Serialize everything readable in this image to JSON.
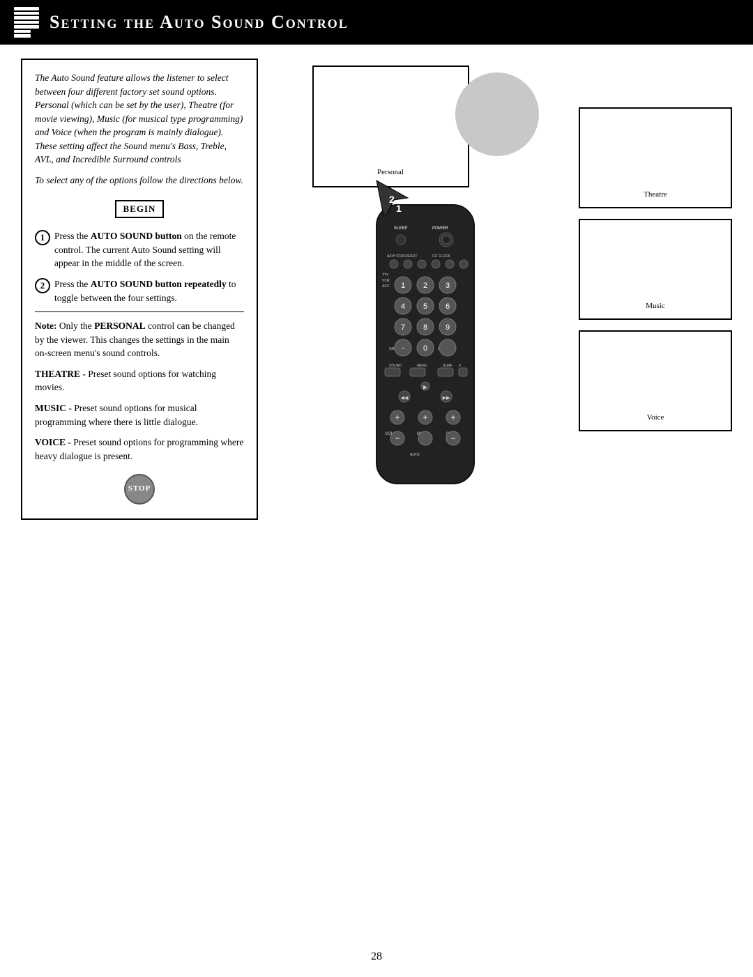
{
  "header": {
    "title": "Setting the Auto Sound Control",
    "icon_label": "remote-icon"
  },
  "instruction_box": {
    "intro": "The Auto Sound feature allows the listener to select between four different factory set sound options. Personal (which can be set by the user), Theatre (for movie viewing), Music (for musical type programming) and Voice (when the program is mainly dialogue). These setting affect the Sound menu's Bass, Treble, AVL, and Incredible Surround controls",
    "intro2": "To select any of the options follow the directions below.",
    "begin_label": "BEGIN",
    "steps": [
      {
        "number": "1",
        "text_before": "Press the ",
        "text_bold": "AUTO  SOUND button",
        "text_after": " on the remote control. The current Auto Sound setting will appear in the middle of the screen."
      },
      {
        "number": "2",
        "text_before": "Press the ",
        "text_bold": "AUTO  SOUND button",
        "text_after_bold": " repeatedly",
        "text_after": " to toggle between the four settings."
      }
    ],
    "note_label": "Note:",
    "note_text": " Only the ",
    "note_bold": "PERSONAL",
    "note_rest": " control can be changed by the viewer. This changes the settings in the main on-screen menu's sound controls.",
    "theatre_bold": "THEATRE",
    "theatre_text": " - Preset sound options for watching movies.",
    "music_bold": "MUSIC",
    "music_text": " - Preset sound options for musical programming where there is little dialogue.",
    "voice_bold": "VOICE",
    "voice_text": " - Preset sound options for programming where heavy dialogue is present.",
    "stop_label": "Stop"
  },
  "screens": {
    "main_label": "Personal",
    "screen2_label": "Theatre",
    "screen3_label": "Music",
    "screen4_label": "Voice"
  },
  "page_number": "28"
}
